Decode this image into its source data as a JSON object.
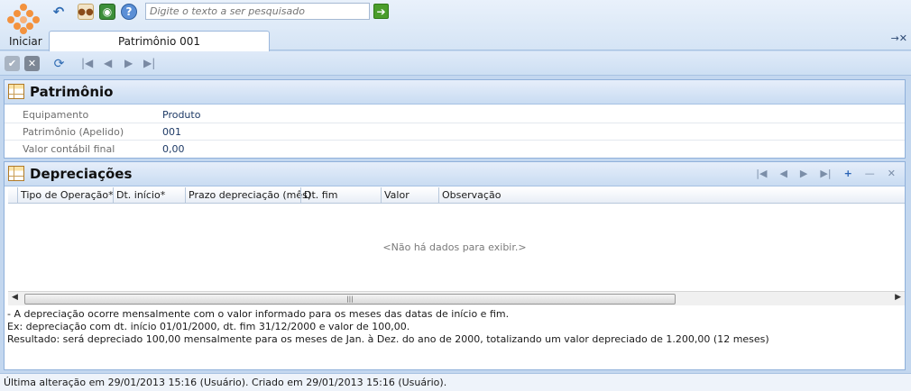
{
  "toolbar": {
    "start_label": "Iniciar",
    "search_placeholder": "Digite o texto a ser pesquisado",
    "icons": [
      "undo-icon",
      "users-icon",
      "view-icon",
      "help-icon"
    ]
  },
  "tab": {
    "label": "Patrimônio 001"
  },
  "patrimonio": {
    "title": "Patrimônio",
    "fields": [
      {
        "label": "Equipamento",
        "value": "Produto"
      },
      {
        "label": "Patrimônio (Apelido)",
        "value": "001"
      },
      {
        "label": "Valor contábil final",
        "value": "0,00"
      }
    ]
  },
  "depreciacoes": {
    "title": "Depreciações",
    "columns": [
      "Tipo de Operação*",
      "Dt. início*",
      "Prazo depreciação (mês)",
      "Dt. fim",
      "Valor",
      "Observação"
    ],
    "empty_message": "<Não há dados para exibir.>",
    "notes": [
      "- A depreciação ocorre mensalmente com o valor informado para os meses das datas de início e fim.",
      "Ex: depreciação com dt. início 01/01/2000, dt. fim 31/12/2000 e valor de 100,00.",
      "Resultado: será depreciado 100,00 mensalmente para os meses de Jan. à Dez. do ano de 2000, totalizando um valor depreciado de 1.200,00 (12 meses)"
    ]
  },
  "status_bar": {
    "text": "Última alteração em 29/01/2013 15:16 (Usuário). Criado em 29/01/2013 15:16 (Usuário)."
  },
  "colors": {
    "accent": "#f3923e",
    "panel_border": "#8fb0da",
    "background": "#c3d7ef"
  }
}
